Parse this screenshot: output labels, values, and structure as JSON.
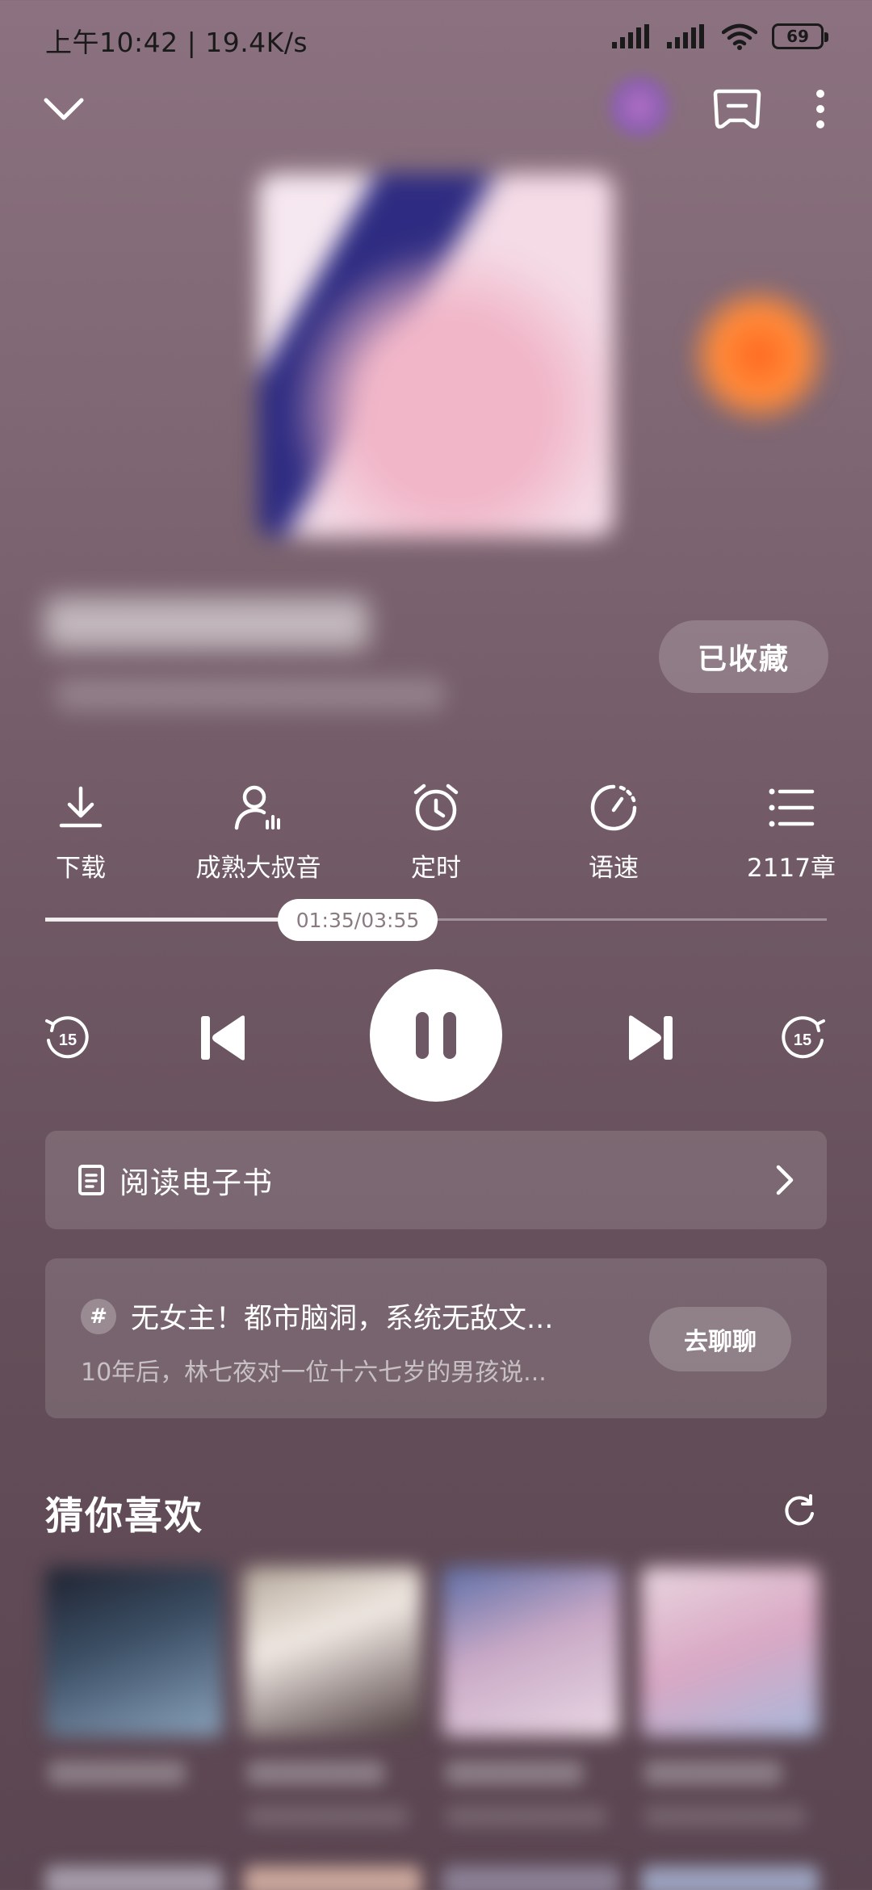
{
  "status_bar": {
    "time_speed": "上午10:42 | 19.4K/s",
    "battery": "69"
  },
  "player": {
    "collect_label": "已收藏",
    "actions": [
      {
        "icon": "download-icon",
        "label": "下载"
      },
      {
        "icon": "voice-icon",
        "label": "成熟大叔音"
      },
      {
        "icon": "alarm-icon",
        "label": "定时"
      },
      {
        "icon": "speed-icon",
        "label": "语速"
      },
      {
        "icon": "chapter-list-icon",
        "label": "2117章"
      }
    ],
    "time": "01:35/03:55",
    "progress": 0.4,
    "rewind_seconds": "15",
    "forward_seconds": "15"
  },
  "ebook": {
    "label": "阅读电子书"
  },
  "chat": {
    "hash": "#",
    "title": "无女主！都市脑洞，系统无敌文...",
    "desc": "10年后，林七夜对一位十六七岁的男孩说...",
    "button": "去聊聊"
  },
  "recommend": {
    "title": "猜你喜欢"
  }
}
